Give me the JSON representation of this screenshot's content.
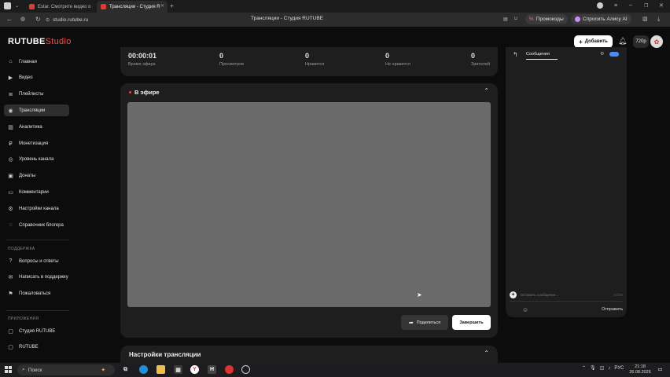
{
  "browser": {
    "tabs": [
      {
        "label": "Estar. Смотрите видео о",
        "active": false
      },
      {
        "label": "Трансляции - Студия R",
        "active": true
      }
    ],
    "url": "studio.rutube.ru",
    "page_title": "Трансляции - Студия RUTUBE",
    "promo_label": "Промокоды",
    "alice_label": "Спросить Алису AI"
  },
  "app": {
    "logo_main": "RUTUBE",
    "logo_sub": "Studio",
    "add_button": "Добавить",
    "quality": "720p"
  },
  "sidebar": {
    "items": [
      {
        "label": "Главная",
        "icon": "home-icon",
        "glyph": "⌂",
        "active": false
      },
      {
        "label": "Видео",
        "icon": "video-icon",
        "glyph": "▶",
        "active": false
      },
      {
        "label": "Плейлисты",
        "icon": "playlist-icon",
        "glyph": "≣",
        "active": false
      },
      {
        "label": "Трансляции",
        "icon": "broadcast-icon",
        "glyph": "◉",
        "active": true
      },
      {
        "label": "Аналитика",
        "icon": "analytics-icon",
        "glyph": "▥",
        "active": false
      },
      {
        "label": "Монетизация",
        "icon": "monetization-icon",
        "glyph": "₽",
        "active": false
      },
      {
        "label": "Уровень канала",
        "icon": "level-icon",
        "glyph": "◎",
        "active": false
      },
      {
        "label": "Донаты",
        "icon": "donate-icon",
        "glyph": "▣",
        "active": false
      },
      {
        "label": "Комментарии",
        "icon": "comments-icon",
        "glyph": "▭",
        "active": false
      },
      {
        "label": "Настройки канала",
        "icon": "settings-icon",
        "glyph": "⚙",
        "active": false
      },
      {
        "label": "Справочник блогера",
        "icon": "guide-icon",
        "glyph": "◌",
        "active": false
      }
    ],
    "support_heading": "ПОДДЕРЖКА",
    "support_items": [
      {
        "label": "Вопросы и ответы",
        "icon": "faq-icon",
        "glyph": "?"
      },
      {
        "label": "Написать в поддержку",
        "icon": "mail-icon",
        "glyph": "✉"
      },
      {
        "label": "Пожаловаться",
        "icon": "flag-icon",
        "glyph": "⚑"
      }
    ],
    "apps_heading": "ПРИЛОЖЕНИЯ",
    "app_items": [
      {
        "label": "Студия RUTUBE",
        "icon": "studio-app-icon",
        "glyph": "▢"
      },
      {
        "label": "RUTUBE",
        "icon": "rutube-app-icon",
        "glyph": "▢"
      }
    ]
  },
  "stats": [
    {
      "value": "00:00:01",
      "label": "Время эфира"
    },
    {
      "value": "0",
      "label": "Просмотров"
    },
    {
      "value": "0",
      "label": "Нравится"
    },
    {
      "value": "0",
      "label": "Не нравится"
    },
    {
      "value": "0",
      "label": "Зрителей"
    }
  ],
  "live": {
    "title": "В эфире",
    "share_button": "Поделиться",
    "finish_button": "Завершить"
  },
  "settings": {
    "title": "Настройки трансляции"
  },
  "chat": {
    "tab_label": "Сообщения",
    "input_placeholder": "Оставить сообщение...",
    "char_count": "0/200",
    "send_button": "Отправить"
  },
  "taskbar": {
    "search_placeholder": "Поиск",
    "language": "РУС",
    "time": "21:18",
    "date": "26.08.2026"
  },
  "colors": {
    "accent_red": "#ff3d3d",
    "page_bg": "#0c0c0c",
    "card_bg": "#1e1e1e"
  }
}
